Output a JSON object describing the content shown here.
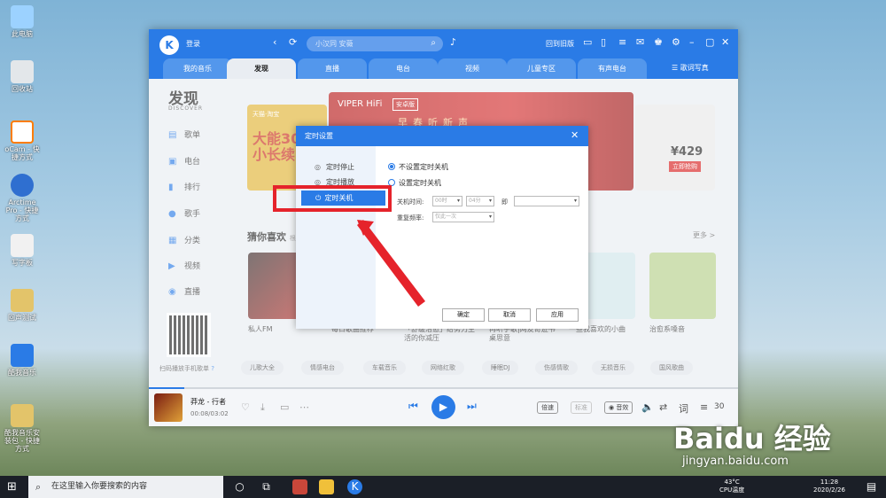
{
  "desktop": {
    "icons": [
      "此电脑",
      "回收站",
      "oCam - 快捷方式",
      "Arctime Pro - 快捷方式",
      "写字板",
      "回声测试",
      "酷我音乐",
      "酷我音乐安装包 - 快捷方式"
    ]
  },
  "app": {
    "login": "登录",
    "search_placeholder": "小汉同 安薇",
    "old_version": "回到旧版",
    "lyrics": "歌词写真",
    "tabs": [
      "我的音乐",
      "发现",
      "直播",
      "电台",
      "视频",
      "儿童专区",
      "有声电台"
    ],
    "active_tab": "发现",
    "accent": "#2a7be6"
  },
  "sidebar": {
    "title": "发现",
    "subtitle": "DISCOVER",
    "items": [
      "歌单",
      "电台",
      "排行",
      "歌手",
      "分类",
      "视频",
      "直播"
    ],
    "qr_label": "扫码播放手机歌单"
  },
  "main": {
    "banner_center_title": "VIPER HiFi",
    "banner_center_badge": "安卓版",
    "banner_center_sub": "早春听新声",
    "banner_left_text": "大能30小长续",
    "banner_left_shop": "天猫·淘宝",
    "banner_right_price": "¥429",
    "banner_right_cta": "立即抢购",
    "section_title": "猜你喜欢",
    "section_hint": "根",
    "more": "更多 >",
    "cards": [
      "私人FM",
      "每日歌曲推荐",
      "「舒缓治愈」给努力生活的你减压",
      "再听手歌|网友奇迹书桌思意",
      "一些我喜欢的小曲",
      "治愈系嗓音"
    ],
    "chips": [
      "儿歌大全",
      "情感电台",
      "车载音乐",
      "网络红歌",
      "睡眠DJ",
      "伤感情歌",
      "无损音乐",
      "国风歌曲"
    ]
  },
  "player": {
    "song": "莽龙 - 行者",
    "time": "00:08/03:02",
    "speed": "倍速",
    "quality": "标准",
    "effect": "音效",
    "count": "30",
    "progress": 0.06
  },
  "dialog": {
    "title": "定时设置",
    "left_options": [
      "定时停止",
      "定时播放"
    ],
    "selected_option": "定时关机",
    "radio_off": "不设置定时关机",
    "radio_on": "设置定时关机",
    "time_label": "关机时间:",
    "hour": "00时",
    "minute": "04分",
    "ji": "即",
    "freq_label": "重复频率:",
    "freq_value": "仅此一次",
    "ok": "确定",
    "cancel": "取消",
    "apply": "应用"
  },
  "watermark": {
    "brand": "Baidu 经验",
    "url": "jingyan.baidu.com"
  },
  "taskbar": {
    "search": "在这里输入你要搜索的内容",
    "temp": "43°C",
    "cpu": "CPU温度",
    "time": "11:28",
    "date": "2020/2/26"
  }
}
